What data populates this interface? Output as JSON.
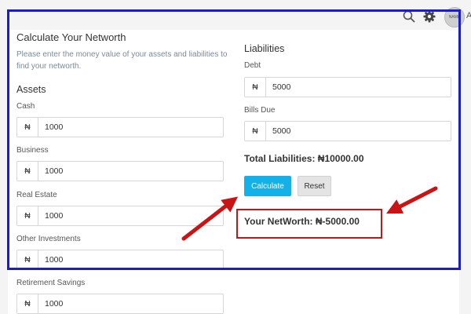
{
  "topbar": {
    "icons": [
      "search-icon",
      "gear-icon"
    ],
    "avatar_text": "NAME",
    "trailing_letter": "A"
  },
  "form": {
    "title": "Calculate Your Networth",
    "description": "Please enter the money value of your assets and liabilities to find your networth.",
    "currency_symbol": "₦"
  },
  "assets": {
    "heading": "Assets",
    "fields": [
      {
        "label": "Cash",
        "value": "1000"
      },
      {
        "label": "Business",
        "value": "1000"
      },
      {
        "label": "Real Estate",
        "value": "1000"
      },
      {
        "label": "Other Investments",
        "value": "1000"
      },
      {
        "label": "Retirement Savings",
        "value": "1000"
      }
    ]
  },
  "liabilities": {
    "heading": "Liabilities",
    "fields": [
      {
        "label": "Debt",
        "value": "5000"
      },
      {
        "label": "Bills Due",
        "value": "5000"
      }
    ],
    "total_text": "Total Liabilities: ₦10000.00"
  },
  "actions": {
    "calculate_label": "Calculate",
    "reset_label": "Reset"
  },
  "result": {
    "networth_text": "Your NetWorth: ₦-5000.00"
  },
  "colors": {
    "highlight_frame": "#1c1ccf",
    "annotation_red": "#c81414",
    "primary_button": "#14b0e8"
  }
}
